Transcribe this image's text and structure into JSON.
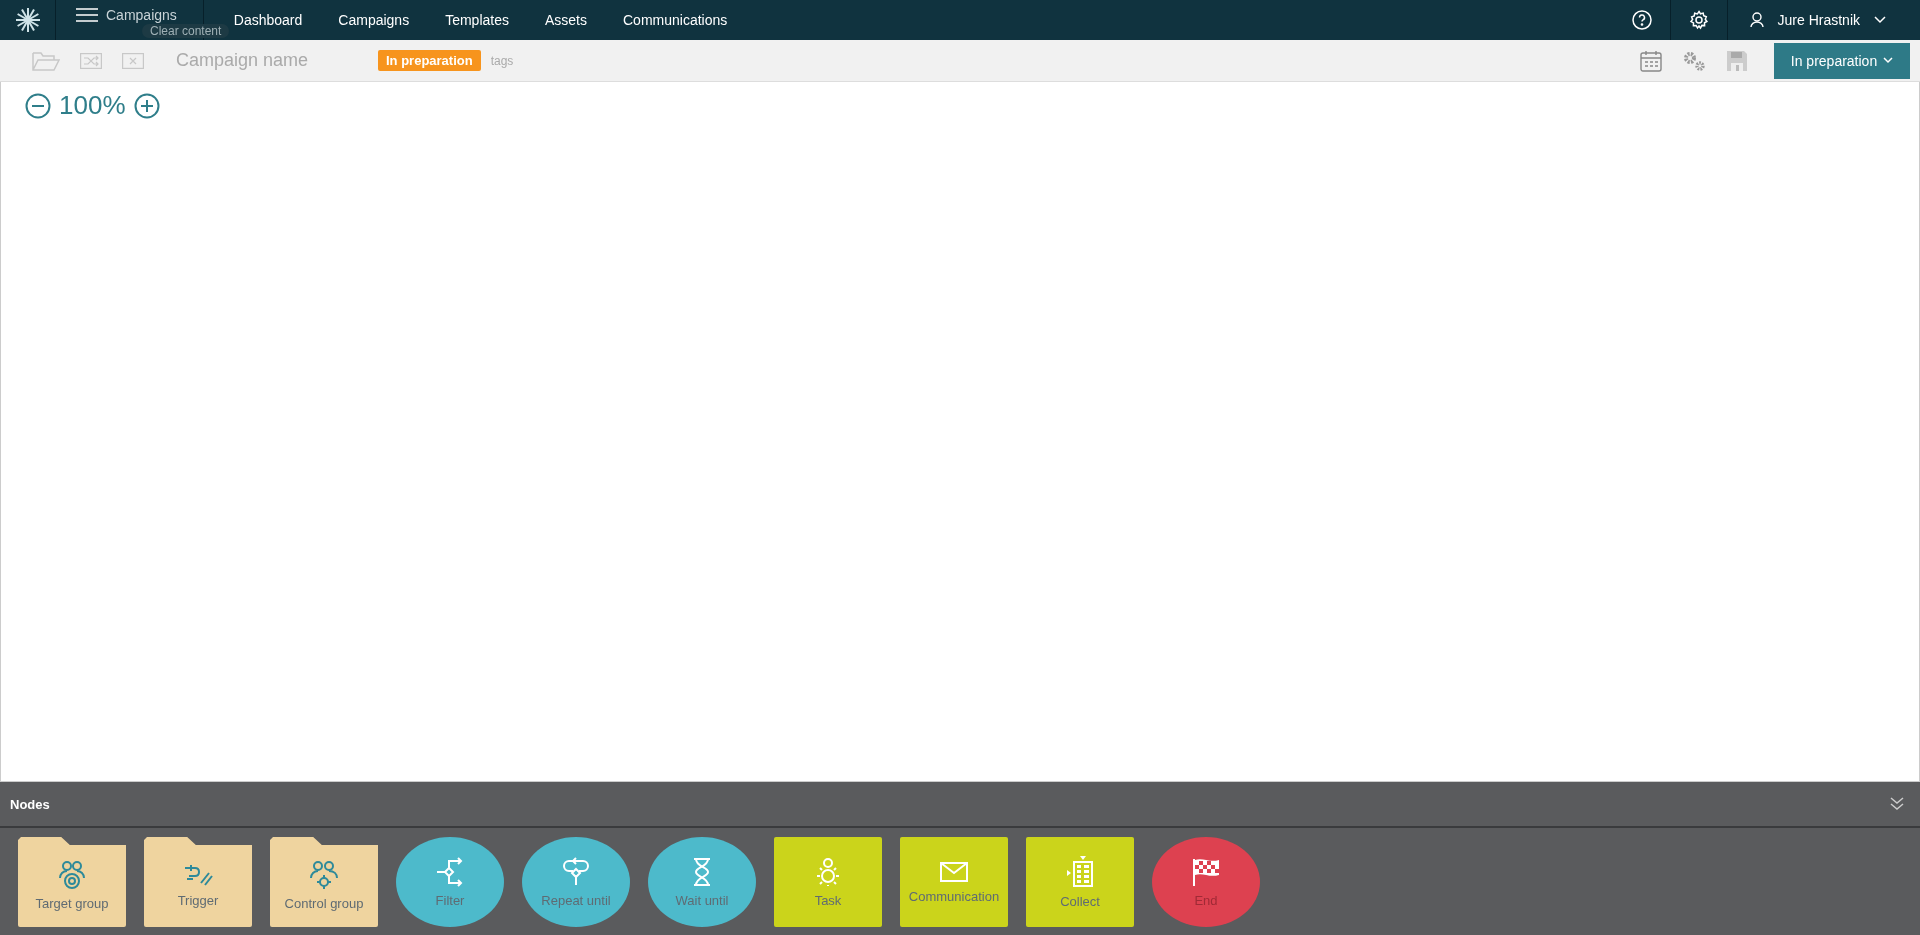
{
  "app_bar": {
    "menu_label": "Campaigns",
    "tooltip": "Clear content",
    "nav": [
      {
        "label": "Dashboard"
      },
      {
        "label": "Campaigns"
      },
      {
        "label": "Templates"
      },
      {
        "label": "Assets"
      },
      {
        "label": "Communications"
      }
    ],
    "user": "Jure Hrastnik"
  },
  "toolbar": {
    "name_placeholder": "Campaign name",
    "status_badge": "In preparation",
    "tags_placeholder": "tags",
    "status_button": "In preparation"
  },
  "zoom": {
    "value": "100%"
  },
  "nodes_panel": {
    "title": "Nodes",
    "nodes": [
      {
        "label": "Target group",
        "kind": "folder",
        "color": "#efd49f"
      },
      {
        "label": "Trigger",
        "kind": "folder",
        "color": "#efd49f"
      },
      {
        "label": "Control group",
        "kind": "folder",
        "color": "#efd49f"
      },
      {
        "label": "Filter",
        "kind": "round",
        "color": "#4dbacb"
      },
      {
        "label": "Repeat until",
        "kind": "round",
        "color": "#4dbacb"
      },
      {
        "label": "Wait until",
        "kind": "round",
        "color": "#4dbacb"
      },
      {
        "label": "Task",
        "kind": "square",
        "color": "#cbd41b"
      },
      {
        "label": "Communication",
        "kind": "square",
        "color": "#cbd41b"
      },
      {
        "label": "Collect",
        "kind": "square",
        "color": "#cbd41b"
      },
      {
        "label": "End",
        "kind": "round",
        "color": "#dd4150"
      }
    ]
  }
}
